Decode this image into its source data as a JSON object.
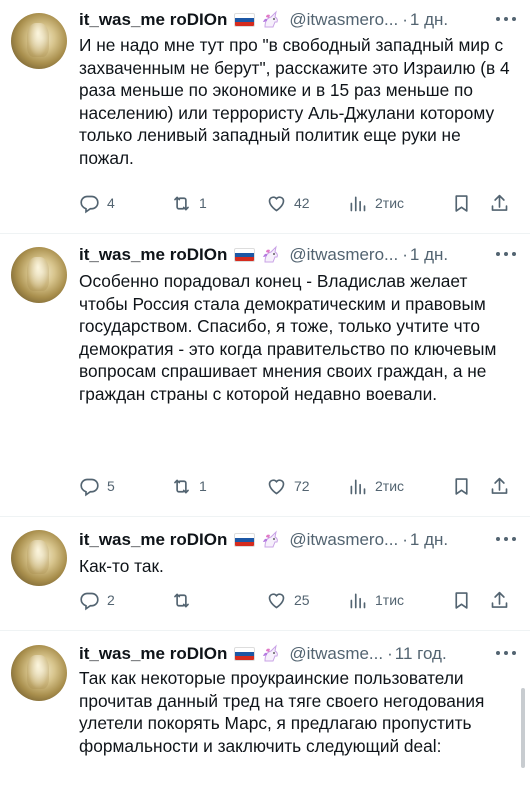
{
  "tweets": [
    {
      "username": "it_was_me roDIOn",
      "handle": "@itwasmero...",
      "dot": "·",
      "time": "1 дн.",
      "text": "И не надо мне тут про \"в свободный западный мир с захваченным не берут\", расскажите это Израилю (в 4 раза меньше по экономике и в 15 раз меньше по населению) или террористу Аль-Джулани которому только ленивый западный политик еще руки не пожал.",
      "replies": "4",
      "retweets": "1",
      "likes": "42",
      "views": "2тис"
    },
    {
      "username": "it_was_me roDIOn",
      "handle": "@itwasmero...",
      "dot": "·",
      "time": "1 дн.",
      "text": "Особенно порадовал конец - Владислав желает чтобы Россия стала демократическим и правовым государством. Спасибо, я тоже, только учтите что демократия - это когда правительство по ключевым вопросам спрашивает мнения своих граждан, а не граждан страны с которой недавно воевали.",
      "replies": "5",
      "retweets": "1",
      "likes": "72",
      "views": "2тис"
    },
    {
      "username": "it_was_me roDIOn",
      "handle": "@itwasmero...",
      "dot": "·",
      "time": "1 дн.",
      "text": "Как-то так.",
      "replies": "2",
      "retweets": "",
      "likes": "25",
      "views": "1тис"
    },
    {
      "username": "it_was_me roDIOn",
      "handle": "@itwasme...",
      "dot": "·",
      "time": "11 год.",
      "text": "Так как некоторые проукраинские пользователи прочитав данный тред на тяге своего негодования улетели покорять Марс, я предлагаю пропустить формальности и заключить следующий deal:",
      "replies": "",
      "retweets": "",
      "likes": "",
      "views": ""
    }
  ],
  "icons": {
    "reply": "reply-icon",
    "retweet": "retweet-icon",
    "like": "heart-icon",
    "views": "views-icon",
    "bookmark": "bookmark-icon",
    "share": "share-icon"
  },
  "colors": {
    "text": "#0f1419",
    "secondary": "#536471",
    "divider": "#eff3f4"
  }
}
